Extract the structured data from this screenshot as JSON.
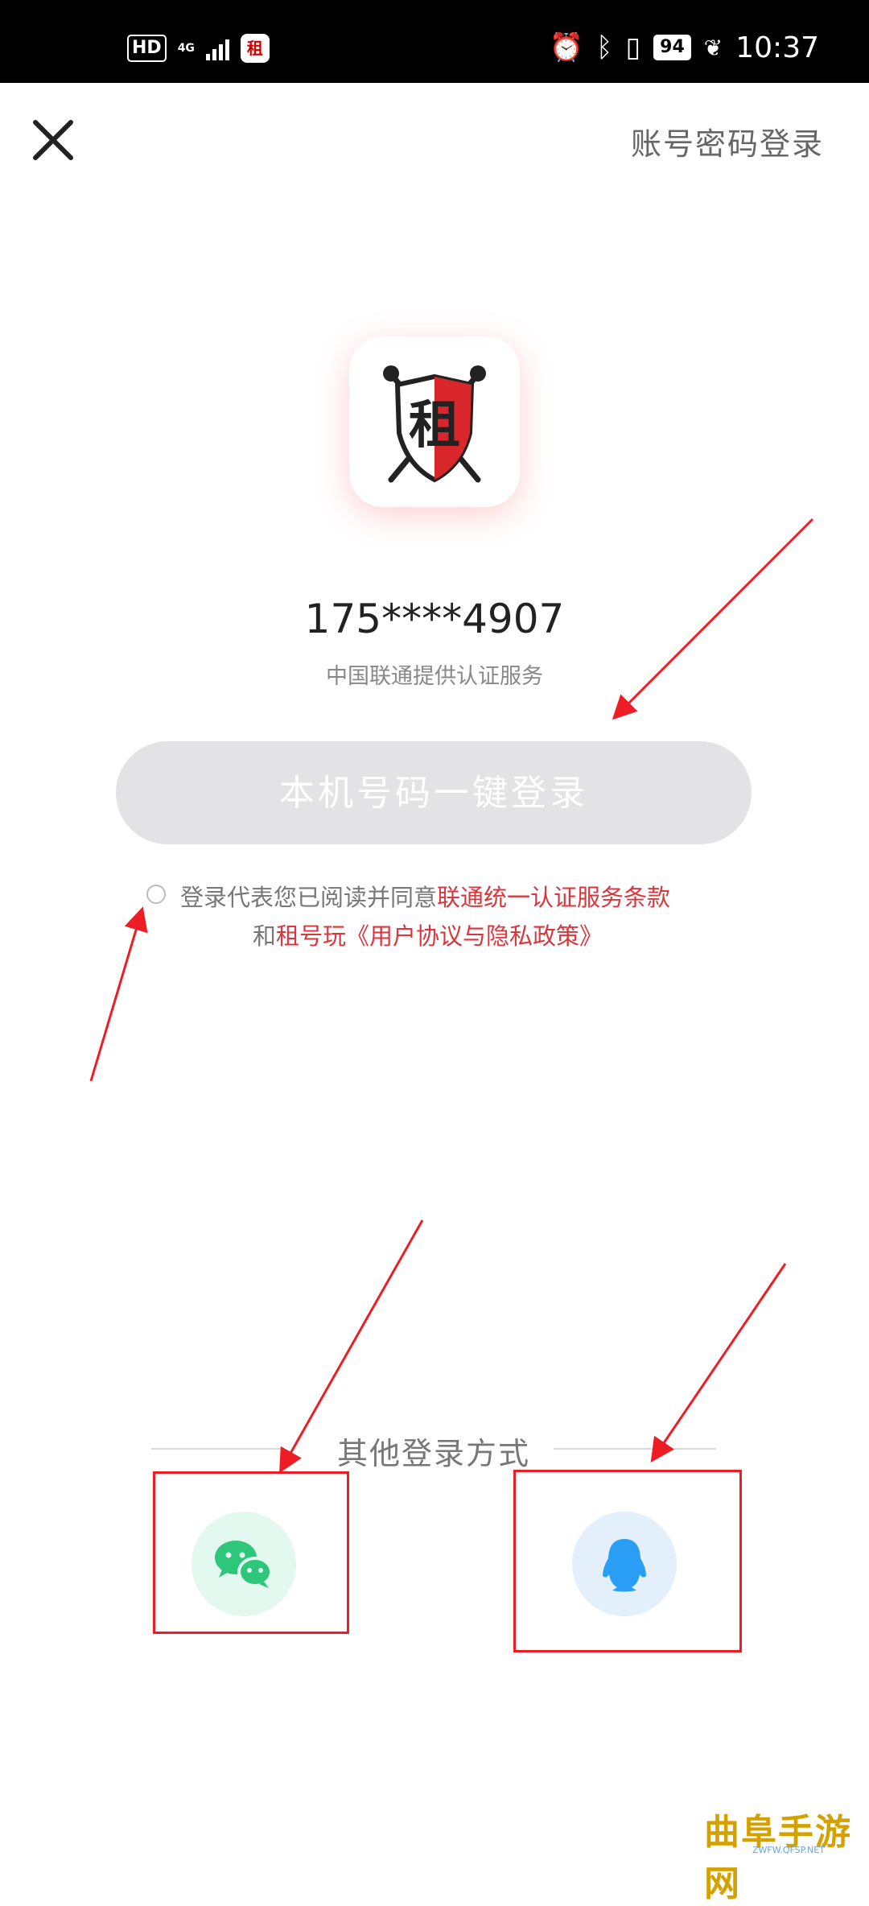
{
  "status_bar": {
    "hd": "HD",
    "network": "4G",
    "battery": "94",
    "time": "10:37"
  },
  "header": {
    "password_login": "账号密码登录"
  },
  "main": {
    "phone_masked": "175****4907",
    "provider_note": "中国联通提供认证服务",
    "one_key_login": "本机号码一键登录"
  },
  "agreement": {
    "prefix": "登录代表您已阅读并同意",
    "carrier_terms": "联通统一认证服务条款",
    "and": "和",
    "app_terms": "租号玩《用户协议与隐私政策》"
  },
  "other_login": {
    "label": "其他登录方式",
    "options": [
      "wechat-icon",
      "qq-icon"
    ]
  },
  "watermark": {
    "title": "曲阜手游网",
    "url": "ZWFW.QFSP.NET"
  },
  "colors": {
    "accent_red": "#d9363e",
    "button_disabled": "#e3e3e6",
    "wechat_green": "#2dc67a",
    "qq_blue": "#2a9df4",
    "annotation_red": "#ee1c25"
  }
}
